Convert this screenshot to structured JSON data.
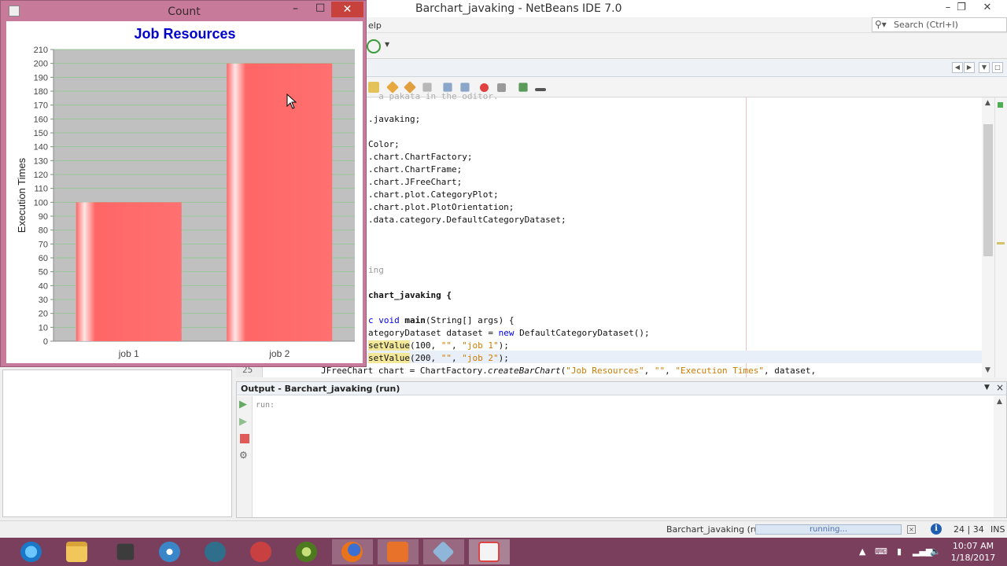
{
  "ide": {
    "window_title": "Barchart_javaking - NetBeans IDE 7.0",
    "menu_help_fragment": "elp",
    "search_placeholder": "Search (Ctrl+I)",
    "line_number": "25",
    "code_lines": [
      {
        "text": ".javaking;",
        "style": "normal"
      },
      {
        "text": "Color;",
        "style": "normal"
      },
      {
        "text": ".chart.ChartFactory;",
        "style": "normal"
      },
      {
        "text": ".chart.ChartFrame;",
        "style": "normal"
      },
      {
        "text": ".chart.JFreeChart;",
        "style": "normal"
      },
      {
        "text": ".chart.plot.CategoryPlot;",
        "style": "normal"
      },
      {
        "text": ".chart.plot.PlotOrientation;",
        "style": "normal"
      },
      {
        "text": ".data.category.DefaultCategoryDataset;",
        "style": "normal"
      },
      {
        "text": "ing",
        "style": "dim"
      },
      {
        "text": "chart_javaking {",
        "style": "normal"
      }
    ],
    "code_main": {
      "pre": "c void ",
      "name": "main",
      "post": "(String[] args) {"
    },
    "code_dataset": {
      "pre": "ategoryDataset dataset = ",
      "kw": "new",
      "post": " DefaultCategoryDataset();"
    },
    "code_set1": {
      "fn": "setValue",
      "a": "(100, ",
      "s1": "\"\"",
      "b": ", ",
      "s2": "\"job 1\"",
      "c": ");"
    },
    "code_set2": {
      "fn": "setValue",
      "a": "(200, ",
      "s1": "\"\"",
      "b": ", ",
      "s2": "\"job 2\"",
      "c": ");"
    },
    "code_line25": {
      "pre": "JFreeChart chart = ChartFactory.",
      "fn": "createBarChart",
      "a": "(",
      "s1": "\"Job Resources\"",
      "b": ", ",
      "s2": "\"\"",
      "c": ", ",
      "s3": "\"Execution Times\"",
      "d": ", dataset,"
    }
  },
  "output": {
    "title": "Output - Barchart_javaking (run)",
    "text": "run:"
  },
  "status": {
    "task": "Barchart_javaking (run)",
    "progress_label": "running...",
    "position": "24 | 34",
    "mode": "INS"
  },
  "chart_window": {
    "title": "Count"
  },
  "chart_data": {
    "type": "bar",
    "title": "Job Resources",
    "xlabel": "",
    "ylabel": "Execution Times",
    "categories": [
      "job 1",
      "job 2"
    ],
    "values": [
      100,
      200
    ],
    "ylim": [
      0,
      210
    ],
    "ytick_step": 10,
    "grid": true,
    "colors": {
      "bar": "#ff6666",
      "plot_bg": "#c0c0c0",
      "title": "#0000cc",
      "grid": "#98c698"
    }
  },
  "taskbar": {
    "items": [
      "internet-explorer-icon",
      "file-explorer-icon",
      "network-tool-icon",
      "dvd-player-icon",
      "video-app-icon",
      "audio-recorder-icon",
      "itunes-icon",
      "firefox-icon",
      "screenshot-tool-icon",
      "virtualbox-icon",
      "java-icon"
    ],
    "clock_time": "10:07 AM",
    "clock_date": "1/18/2017"
  }
}
